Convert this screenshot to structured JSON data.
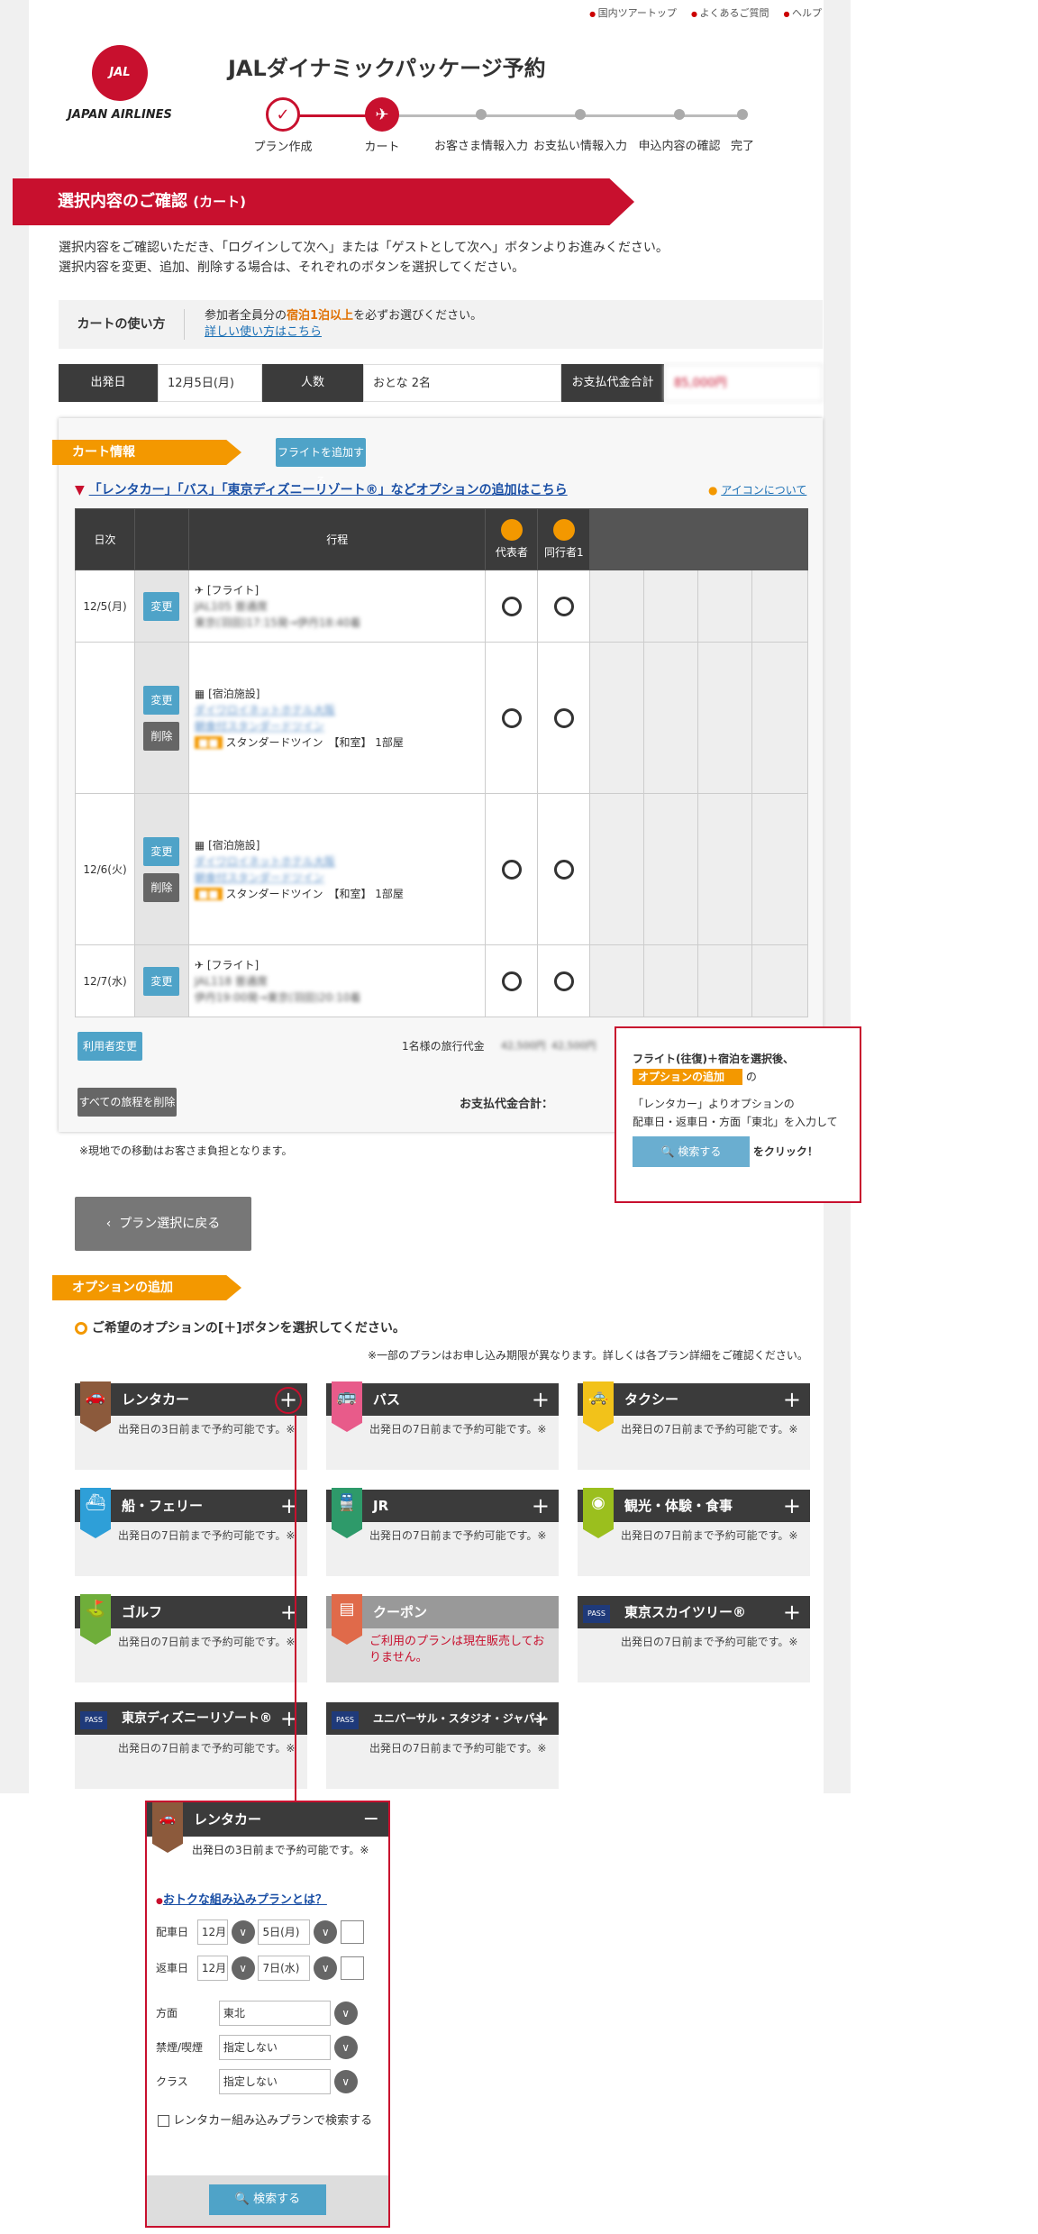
{
  "toplinks": [
    "国内ツアートップ",
    "よくあるご質問",
    "ヘルプ"
  ],
  "logo": {
    "mark": "JAL",
    "text": "JAPAN AIRLINES"
  },
  "title": "JALダイナミックパッケージ予約",
  "steps": [
    "プラン作成",
    "カート",
    "お客さま情報入力",
    "お支払い情報入力",
    "申込内容の確認",
    "完了"
  ],
  "banner": {
    "main": "選択内容のご確認",
    "sub": "(カート)"
  },
  "intro": [
    "選択内容をご確認いただき、「ログインして次へ」または「ゲストとして次へ」ボタンよりお進みください。",
    "選択内容を変更、追加、削除する場合は、それぞれのボタンを選択してください。"
  ],
  "howto": {
    "label": "カートの使い方",
    "pre": "参加者全員分の",
    "highlight": "宿泊1泊以上",
    "post": "を必ずお選びください。",
    "link": "詳しい使い方はこちら"
  },
  "summary": {
    "dep_label": "出発日",
    "dep": "12月5日(月)",
    "pax_label": "人数",
    "pax": "おとな 2名",
    "pay_label": "お支払代金合計",
    "pay": "85,000円"
  },
  "cart": {
    "tag": "カート情報",
    "add_flight": "フライトを追加する",
    "option_link": "「レンタカー」「バス」「東京ディズニーリゾート®」などオプションの追加はこちら",
    "icon_link": "アイコンについて",
    "headers": {
      "date": "日次",
      "route": "行程",
      "rep": "代表者",
      "comp": "同行者1"
    },
    "rows": [
      {
        "date": "12/5(月)",
        "btns": [
          "変更"
        ],
        "kind": "[フライト]",
        "l1": "JAL105 普通席",
        "l2": "東京(羽田)17:15発→伊丹18:40着"
      },
      {
        "date": "",
        "btns": [
          "変更",
          "削除"
        ],
        "kind": "[宿泊施設]",
        "l1": "ダイワロイネットホテル大阪",
        "l2": "朝食付スタンダードツイン",
        "room": "スタンダードツイン　【和室】 1部屋"
      },
      {
        "date": "12/6(火)",
        "btns": [
          "変更",
          "削除"
        ],
        "kind": "[宿泊施設]",
        "l1": "ダイワロイネットホテル大阪",
        "l2": "朝食付スタンダードツイン",
        "room": "スタンダードツイン　【和室】 1部屋"
      },
      {
        "date": "12/7(水)",
        "btns": [
          "変更"
        ],
        "kind": "[フライト]",
        "l1": "JAL118 普通席",
        "l2": "伊丹19:00発→東京(羽田)20:10着"
      }
    ],
    "user_change": "利用者変更",
    "per_person": "1名様の旅行代金",
    "price1": "42,500円",
    "price2": "42,500円",
    "delete_all": "すべての旅程を削除",
    "total_label": "お支払代金合計：",
    "note": "※現地での移動はお客さま負担となります。"
  },
  "callout": {
    "line1": "フライト(往復)＋宿泊を選択後、",
    "tag": "オプションの追加",
    "no": "の",
    "line2": "「レンタカー」よりオプションの",
    "line3": "配車日・返車日・方面「東北」を入力して",
    "btn": "検索する",
    "click": "をクリック！"
  },
  "back": "プラン選択に戻る",
  "options": {
    "tag": "オプションの追加",
    "instruction": "ご希望のオプションの[＋]ボタンを選択してください。",
    "note": "※一部のプランはお申し込み期限が異なります。詳しくは各プラン詳細をご確認ください。",
    "items": [
      {
        "name": "レンタカー",
        "note": "出発日の3日前まで予約可能です。※",
        "color": "#8c5a3c"
      },
      {
        "name": "バス",
        "note": "出発日の7日前まで予約可能です。※",
        "color": "#e85b8a"
      },
      {
        "name": "タクシー",
        "note": "出発日の7日前まで予約可能です。※",
        "color": "#f2c21a"
      },
      {
        "name": "船・フェリー",
        "note": "出発日の7日前まで予約可能です。※",
        "color": "#2e9fd8"
      },
      {
        "name": "JR",
        "note": "出発日の7日前まで予約可能です。※",
        "color": "#2e9a6a"
      },
      {
        "name": "観光・体験・食事",
        "note": "出発日の7日前まで予約可能です。※",
        "color": "#9bbf1e"
      },
      {
        "name": "ゴルフ",
        "note": "出発日の7日前まで予約可能です。※",
        "color": "#6fae3a"
      },
      {
        "name": "クーポン",
        "note": "ご利用のプランは現在販売しておりません。",
        "color": "#e06a4a"
      },
      {
        "name": "東京スカイツリー®",
        "note": "出発日の7日前まで予約可能です。※",
        "color": "#1f3a7a"
      },
      {
        "name": "東京ディズニーリゾート®",
        "note": "出発日の7日前まで予約可能です。※",
        "color": "#1f3a7a"
      },
      {
        "name": "ユニバーサル・スタジオ・ジャパン",
        "note": "出発日の7日前まで予約可能です。※",
        "color": "#1f3a7a"
      }
    ]
  },
  "panel": {
    "title": "レンタカー",
    "note": "出発日の3日前まで予約可能です。※",
    "link": "おトクな組み込みプランとは？",
    "pickup_label": "配車日",
    "pickup_month": "12月",
    "pickup_day": "5日(月)",
    "return_label": "返車日",
    "return_month": "12月",
    "return_day": "7日(水)",
    "area_label": "方面",
    "area": "東北",
    "smoke_label": "禁煙/喫煙",
    "smoke": "指定しない",
    "class_label": "クラス",
    "class": "指定しない",
    "checkbox": "レンタカー組み込みプランで検索する",
    "search": "検索する"
  }
}
